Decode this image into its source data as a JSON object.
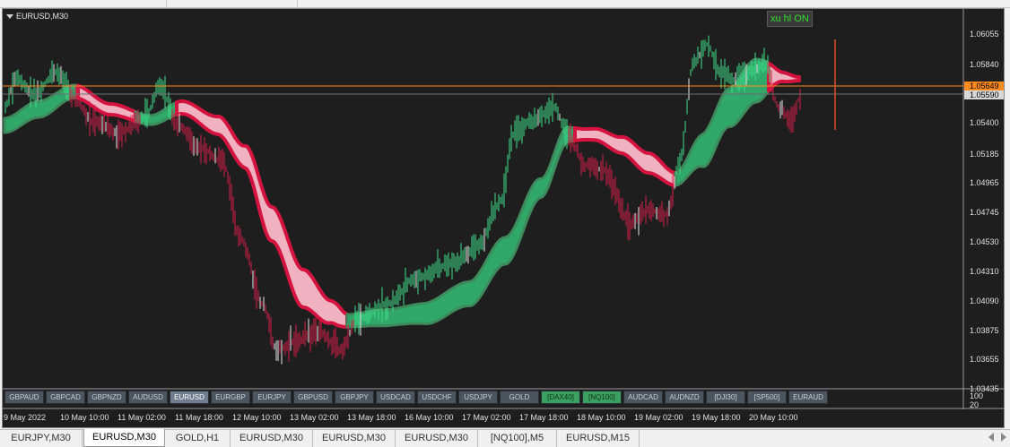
{
  "chart": {
    "title": "EURUSD,M30",
    "indicator_button": "xu hl ON",
    "colors": {
      "background": "#1e1e1e",
      "bull_candle": "#3ee08a",
      "bear_candle": "#d81e4a",
      "doji": "#e8e8e8",
      "green_band_fill": "#2fa86a",
      "green_band_edge": "#3e8a5c",
      "red_band_fill": "#f0b2c0",
      "red_band_edge": "#d4143e",
      "ask_line": "#ff8a1e",
      "bid_line": "#6e6e6e"
    },
    "price_levels": [
      "1.06055",
      "1.05840",
      "1.05400",
      "1.05185",
      "1.04965",
      "1.04745",
      "1.04530",
      "1.04310",
      "1.04090",
      "1.03875",
      "1.03655",
      "1.03435"
    ],
    "ask_price": "1.05649",
    "bid_price": "1.05590",
    "indicator_levels": [
      "100",
      "20"
    ],
    "time_labels": [
      "9 May 2022",
      "10 May 10:00",
      "11 May 02:00",
      "11 May 18:00",
      "12 May 10:00",
      "13 May 02:00",
      "13 May 18:00",
      "16 May 10:00",
      "17 May 02:00",
      "17 May 18:00",
      "18 May 10:00",
      "19 May 02:00",
      "19 May 18:00",
      "20 May 10:00"
    ],
    "symbols": [
      {
        "label": "GBPAUD",
        "state": "normal"
      },
      {
        "label": "GBPCAD",
        "state": "normal"
      },
      {
        "label": "GBPNZD",
        "state": "normal"
      },
      {
        "label": "AUDUSD",
        "state": "normal"
      },
      {
        "label": "EURUSD",
        "state": "active"
      },
      {
        "label": "EURGBP",
        "state": "normal"
      },
      {
        "label": "EURJPY",
        "state": "normal"
      },
      {
        "label": "GBPUSD",
        "state": "normal"
      },
      {
        "label": "GBPJPY",
        "state": "normal"
      },
      {
        "label": "USDCAD",
        "state": "normal"
      },
      {
        "label": "USDCHF",
        "state": "normal"
      },
      {
        "label": "USDJPY",
        "state": "normal"
      },
      {
        "label": "GOLD",
        "state": "normal"
      },
      {
        "label": "[DAX40]",
        "state": "green"
      },
      {
        "label": "[NQ100]",
        "state": "green"
      },
      {
        "label": "AUDCAD",
        "state": "normal"
      },
      {
        "label": "AUDNZD",
        "state": "normal"
      },
      {
        "label": "[DJI30]",
        "state": "normal"
      },
      {
        "label": "[SP500]",
        "state": "normal"
      },
      {
        "label": "EURAUD",
        "state": "normal"
      }
    ]
  },
  "tabs": [
    {
      "label": "EURJPY,M30",
      "active": false
    },
    {
      "label": "EURUSD,M30",
      "active": true
    },
    {
      "label": "GOLD,H1",
      "active": false
    },
    {
      "label": "EURUSD,M30",
      "active": false
    },
    {
      "label": "EURUSD,M30",
      "active": false
    },
    {
      "label": "EURUSD,M30",
      "active": false
    },
    {
      "label": "[NQ100],M5",
      "active": false
    },
    {
      "label": "EURUSD,M15",
      "active": false
    }
  ],
  "tab_scroll": {
    "left_icon": "arrow-left-icon",
    "right_icon": "arrow-right-icon"
  }
}
